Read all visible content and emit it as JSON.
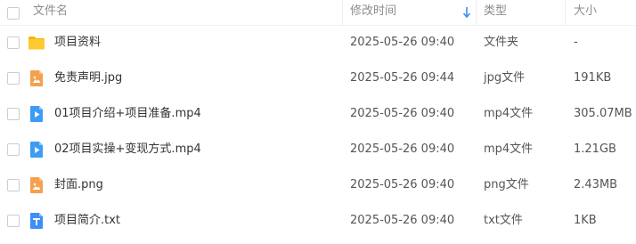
{
  "header": {
    "name_label": "文件名",
    "modified_label": "修改时间",
    "type_label": "类型",
    "size_label": "大小"
  },
  "colors": {
    "folder": "#ffc933",
    "image_file": "#f5a04e",
    "video_file": "#3d9cf4",
    "text_file": "#3d8ef7",
    "sort_arrow": "#3b8cf5"
  },
  "files": [
    {
      "name": "项目资料",
      "modified": "2025-05-26 09:40",
      "type": "文件夹",
      "size": "-",
      "icon": "folder-icon"
    },
    {
      "name": "免责声明.jpg",
      "modified": "2025-05-26 09:44",
      "type": "jpg文件",
      "size": "191KB",
      "icon": "image-file-icon"
    },
    {
      "name": "01项目介绍+项目准备.mp4",
      "modified": "2025-05-26 09:40",
      "type": "mp4文件",
      "size": "305.07MB",
      "icon": "video-file-icon"
    },
    {
      "name": "02项目实操+变现方式.mp4",
      "modified": "2025-05-26 09:40",
      "type": "mp4文件",
      "size": "1.21GB",
      "icon": "video-file-icon"
    },
    {
      "name": "封面.png",
      "modified": "2025-05-26 09:40",
      "type": "png文件",
      "size": "2.43MB",
      "icon": "image-file-icon"
    },
    {
      "name": "项目简介.txt",
      "modified": "2025-05-26 09:40",
      "type": "txt文件",
      "size": "1KB",
      "icon": "text-file-icon"
    }
  ]
}
